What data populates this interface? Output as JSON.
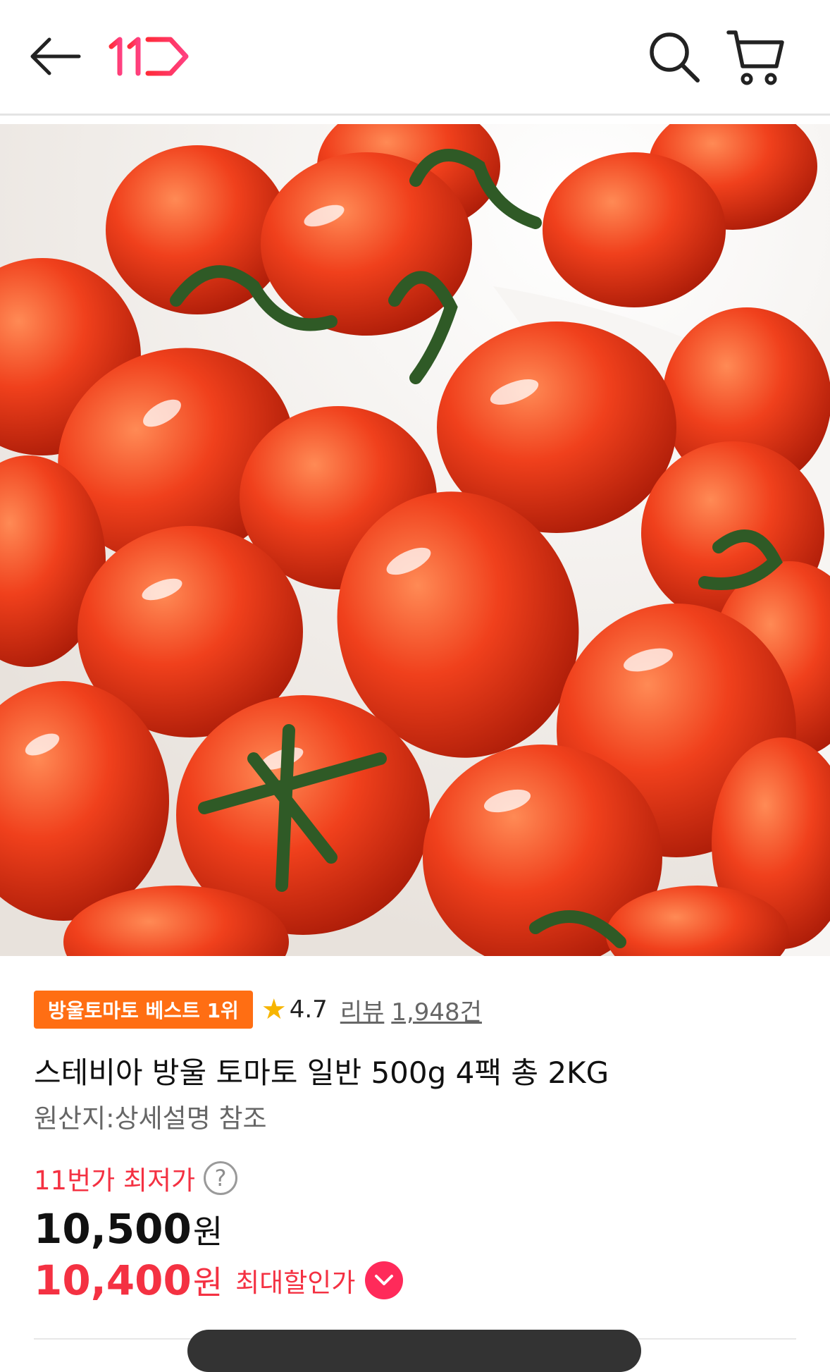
{
  "header": {
    "back_icon": "arrow-left-icon",
    "logo_text": "11",
    "search_icon": "search-icon",
    "cart_icon": "cart-icon"
  },
  "product": {
    "image_subject": "cherry tomatoes",
    "badge": "방울토마토 베스트 1위",
    "rating": "4.7",
    "review_label": "리뷰",
    "review_count": "1,948건",
    "title": "스테비아 방울 토마토 일반 500g 4팩 총 2KG",
    "origin": "원산지:상세설명 참조"
  },
  "price": {
    "lowest_label": "11번가 최저가",
    "help_symbol": "?",
    "price_value": "10,500",
    "price_unit": "원",
    "discount_value": "10,400",
    "discount_unit": "원",
    "discount_label": "최대할인가"
  },
  "colors": {
    "brand": "#f43142",
    "badge": "#ff6e13",
    "star": "#f7b500",
    "toggle": "#ff2a5a"
  }
}
